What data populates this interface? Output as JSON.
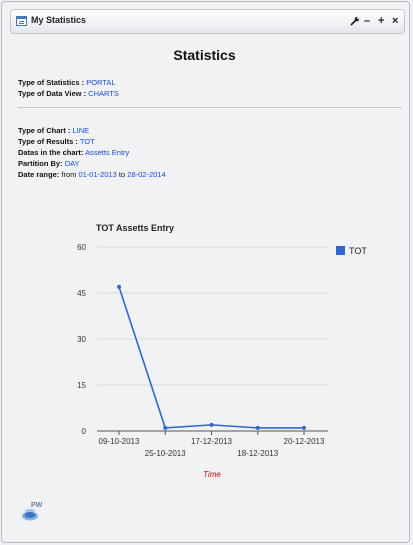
{
  "window": {
    "title": "My Statistics",
    "controls": [
      "wrench",
      "minimize",
      "maximize",
      "close"
    ]
  },
  "heading": "Statistics",
  "info": {
    "type_of_statistics": {
      "label": "Type of Statistics :",
      "value": "PORTAL"
    },
    "type_of_data_view": {
      "label": "Type of Data View :",
      "value": "CHARTS"
    },
    "type_of_chart": {
      "label": "Type of Chart :",
      "value": "LINE"
    },
    "type_of_results": {
      "label": "Type of Results :",
      "value": "TOT"
    },
    "datas_in_chart": {
      "label": "Datas in the chart:",
      "value": "Assetts Entry"
    },
    "partition_by": {
      "label": "Partition By:",
      "value": "DAY"
    },
    "date_range": {
      "label": "Date range:",
      "from_text": "from",
      "from": "01-01-2013",
      "to_text": "to",
      "to": "28-02-2014"
    }
  },
  "logo": {
    "text": "PW"
  },
  "chart_data": {
    "type": "line",
    "title": "TOT Assetts Entry",
    "xlabel": "Time",
    "ylabel": "",
    "categories": [
      "09-10-2013",
      "25-10-2013",
      "17-12-2013",
      "18-12-2013",
      "20-12-2013"
    ],
    "series": [
      {
        "name": "TOT",
        "values": [
          47,
          1,
          2,
          1,
          1
        ],
        "color": "#3366cc"
      }
    ],
    "ylim": [
      0,
      60
    ],
    "yticks": [
      0,
      15,
      30,
      45,
      60
    ],
    "grid": true,
    "legend_position": "top-right",
    "xlabel_color": "#cc0000"
  }
}
